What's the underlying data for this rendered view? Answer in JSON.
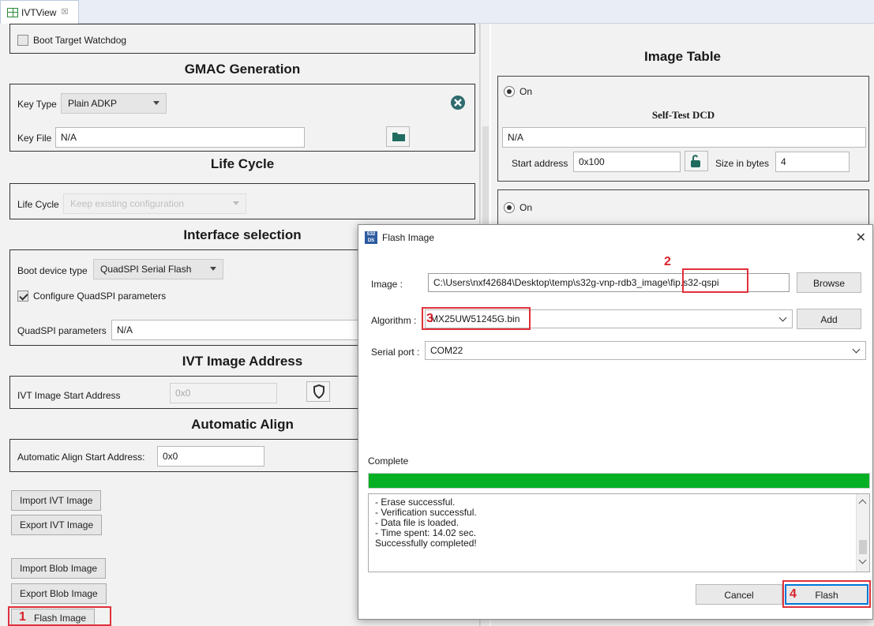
{
  "tab": {
    "title": "IVTView",
    "close": "☒"
  },
  "left": {
    "boot_target_watchdog": "Boot Target Watchdog",
    "gmac": {
      "title": "GMAC Generation",
      "key_type_label": "Key Type",
      "key_type_value": "Plain ADKP",
      "key_file_label": "Key File",
      "key_file_value": "N/A"
    },
    "life_cycle": {
      "title": "Life Cycle",
      "label": "Life Cycle",
      "value": "Keep existing configuration"
    },
    "interface": {
      "title": "Interface selection",
      "boot_device_label": "Boot device type",
      "boot_device_value": "QuadSPI Serial Flash",
      "configure_label": "Configure QuadSPI parameters",
      "configure_checked": true,
      "params_label": "QuadSPI parameters",
      "params_value": "N/A"
    },
    "ivt_address": {
      "title": "IVT Image Address",
      "label": "IVT Image Start Address",
      "value": "0x0"
    },
    "auto_align": {
      "title": "Automatic Align",
      "label": "Automatic Align Start Address:",
      "value": "0x0"
    },
    "buttons": {
      "import_ivt": "Import IVT Image",
      "export_ivt": "Export IVT Image",
      "import_blob": "Import Blob Image",
      "export_blob": "Export Blob Image",
      "flash_image": "Flash Image"
    }
  },
  "right": {
    "image_table_title": "Image Table",
    "entry1": {
      "radio_label": "On",
      "section_title": "Self-Test DCD",
      "value": "N/A",
      "start_label": "Start address",
      "start_value": "0x100",
      "size_label": "Size in bytes",
      "size_value": "4"
    },
    "entry2": {
      "radio_label": "On"
    }
  },
  "dialog": {
    "title": "Flash Image",
    "image_label": "Image :",
    "image_value": "C:\\Users\\nxf42684\\Desktop\\temp\\s32g-vnp-rdb3_image\\fip.s32-qspi",
    "browse": "Browse",
    "algorithm_label": "Algorithm :",
    "algorithm_value": "MX25UW51245G.bin",
    "add": "Add",
    "serial_label": "Serial port :",
    "serial_value": "COM22",
    "status": "Complete",
    "progress": 1.0,
    "log": [
      "- Erase successful.",
      "- Verification successful.",
      "- Data file is loaded.",
      "- Time spent: 14.02 sec.",
      "Successfully completed!"
    ],
    "cancel": "Cancel",
    "flash": "Flash"
  },
  "annotations": {
    "n1": "1",
    "n2": "2",
    "n3": "3",
    "n4": "4"
  },
  "colors": {
    "annotation": "#e0303a",
    "progress": "#06b025",
    "tab_bg": "#e9eef6"
  }
}
